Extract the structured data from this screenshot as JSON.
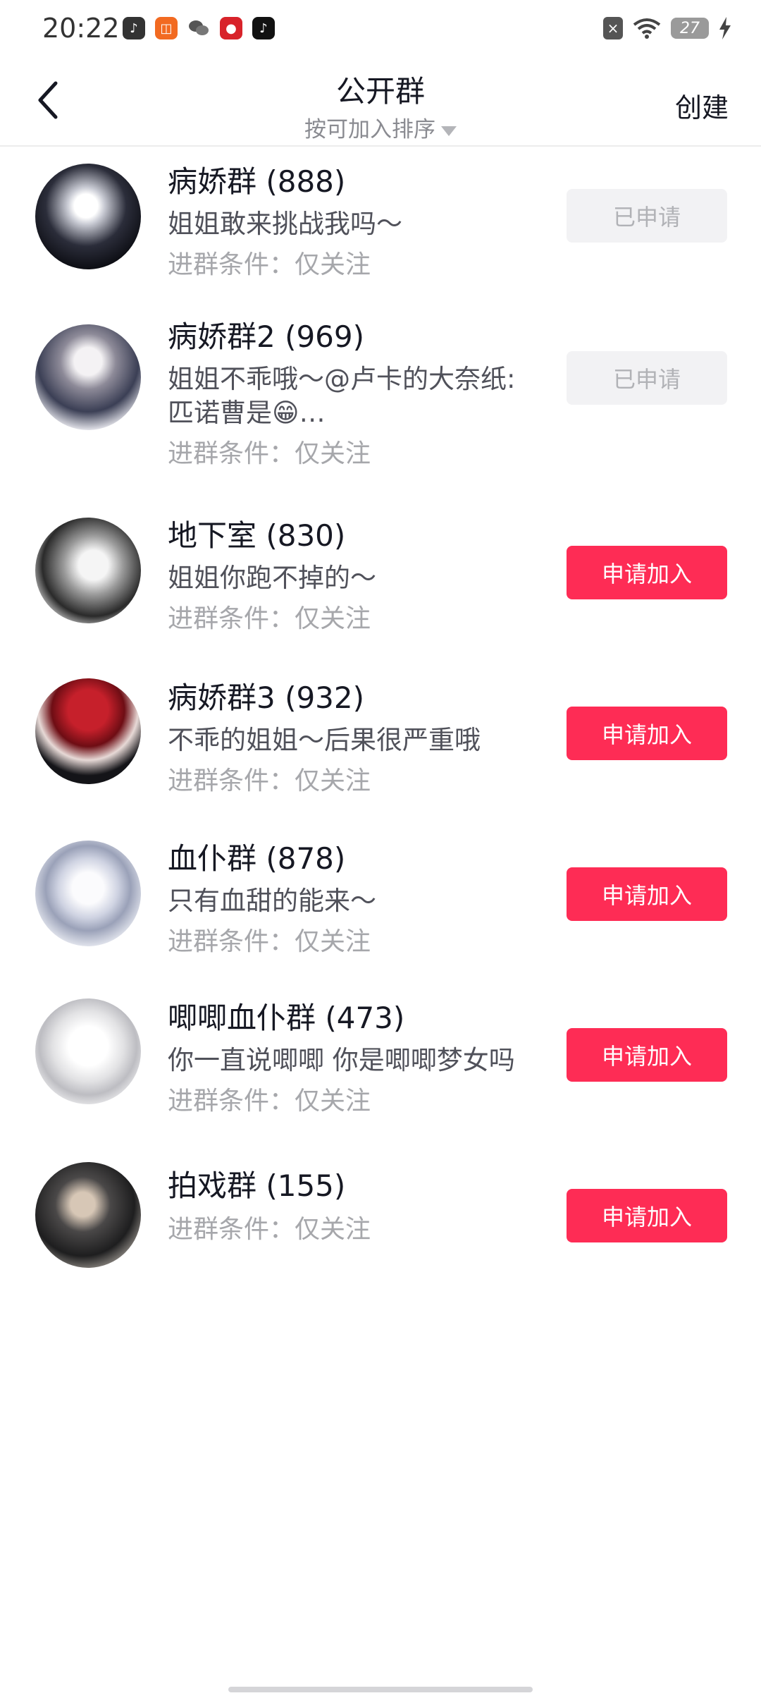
{
  "status_bar": {
    "time": "20:22",
    "battery": "27",
    "app_icons": [
      "douyin-app-icon",
      "orange-app-icon",
      "wechat-icon",
      "red-app-icon",
      "tiktok-icon"
    ]
  },
  "header": {
    "title": "公开群",
    "sort_label": "按可加入排序",
    "create_label": "创建"
  },
  "groups": [
    {
      "name": "病娇群 (888)",
      "desc": "姐姐敢来挑战我吗～",
      "condition": "进群条件：仅关注",
      "button": "已申请",
      "status": "applied"
    },
    {
      "name": "病娇群2 (969)",
      "desc": "姐姐不乖哦～@卢卡的大奈纸:",
      "desc2": "匹诺曹是😁…",
      "condition": "进群条件：仅关注",
      "button": "已申请",
      "status": "applied"
    },
    {
      "name": "地下室 (830)",
      "desc": "姐姐你跑不掉的～",
      "condition": "进群条件：仅关注",
      "button": "申请加入",
      "status": "join"
    },
    {
      "name": "病娇群3 (932)",
      "desc": "不乖的姐姐～后果很严重哦",
      "condition": "进群条件：仅关注",
      "button": "申请加入",
      "status": "join"
    },
    {
      "name": "血仆群 (878)",
      "desc": "只有血甜的能来～",
      "condition": "进群条件：仅关注",
      "button": "申请加入",
      "status": "join"
    },
    {
      "name": "唧唧血仆群 (473)",
      "desc": "你一直说唧唧 你是唧唧梦女吗",
      "condition": "进群条件：仅关注",
      "button": "申请加入",
      "status": "join"
    },
    {
      "name": "拍戏群 (155)",
      "condition": "进群条件：仅关注",
      "button": "申请加入",
      "status": "join"
    }
  ],
  "colors": {
    "accent": "#fe2c55",
    "applied_bg": "#f2f2f4",
    "applied_text": "#b1b2b6",
    "secondary_text": "#a6a7ab"
  }
}
